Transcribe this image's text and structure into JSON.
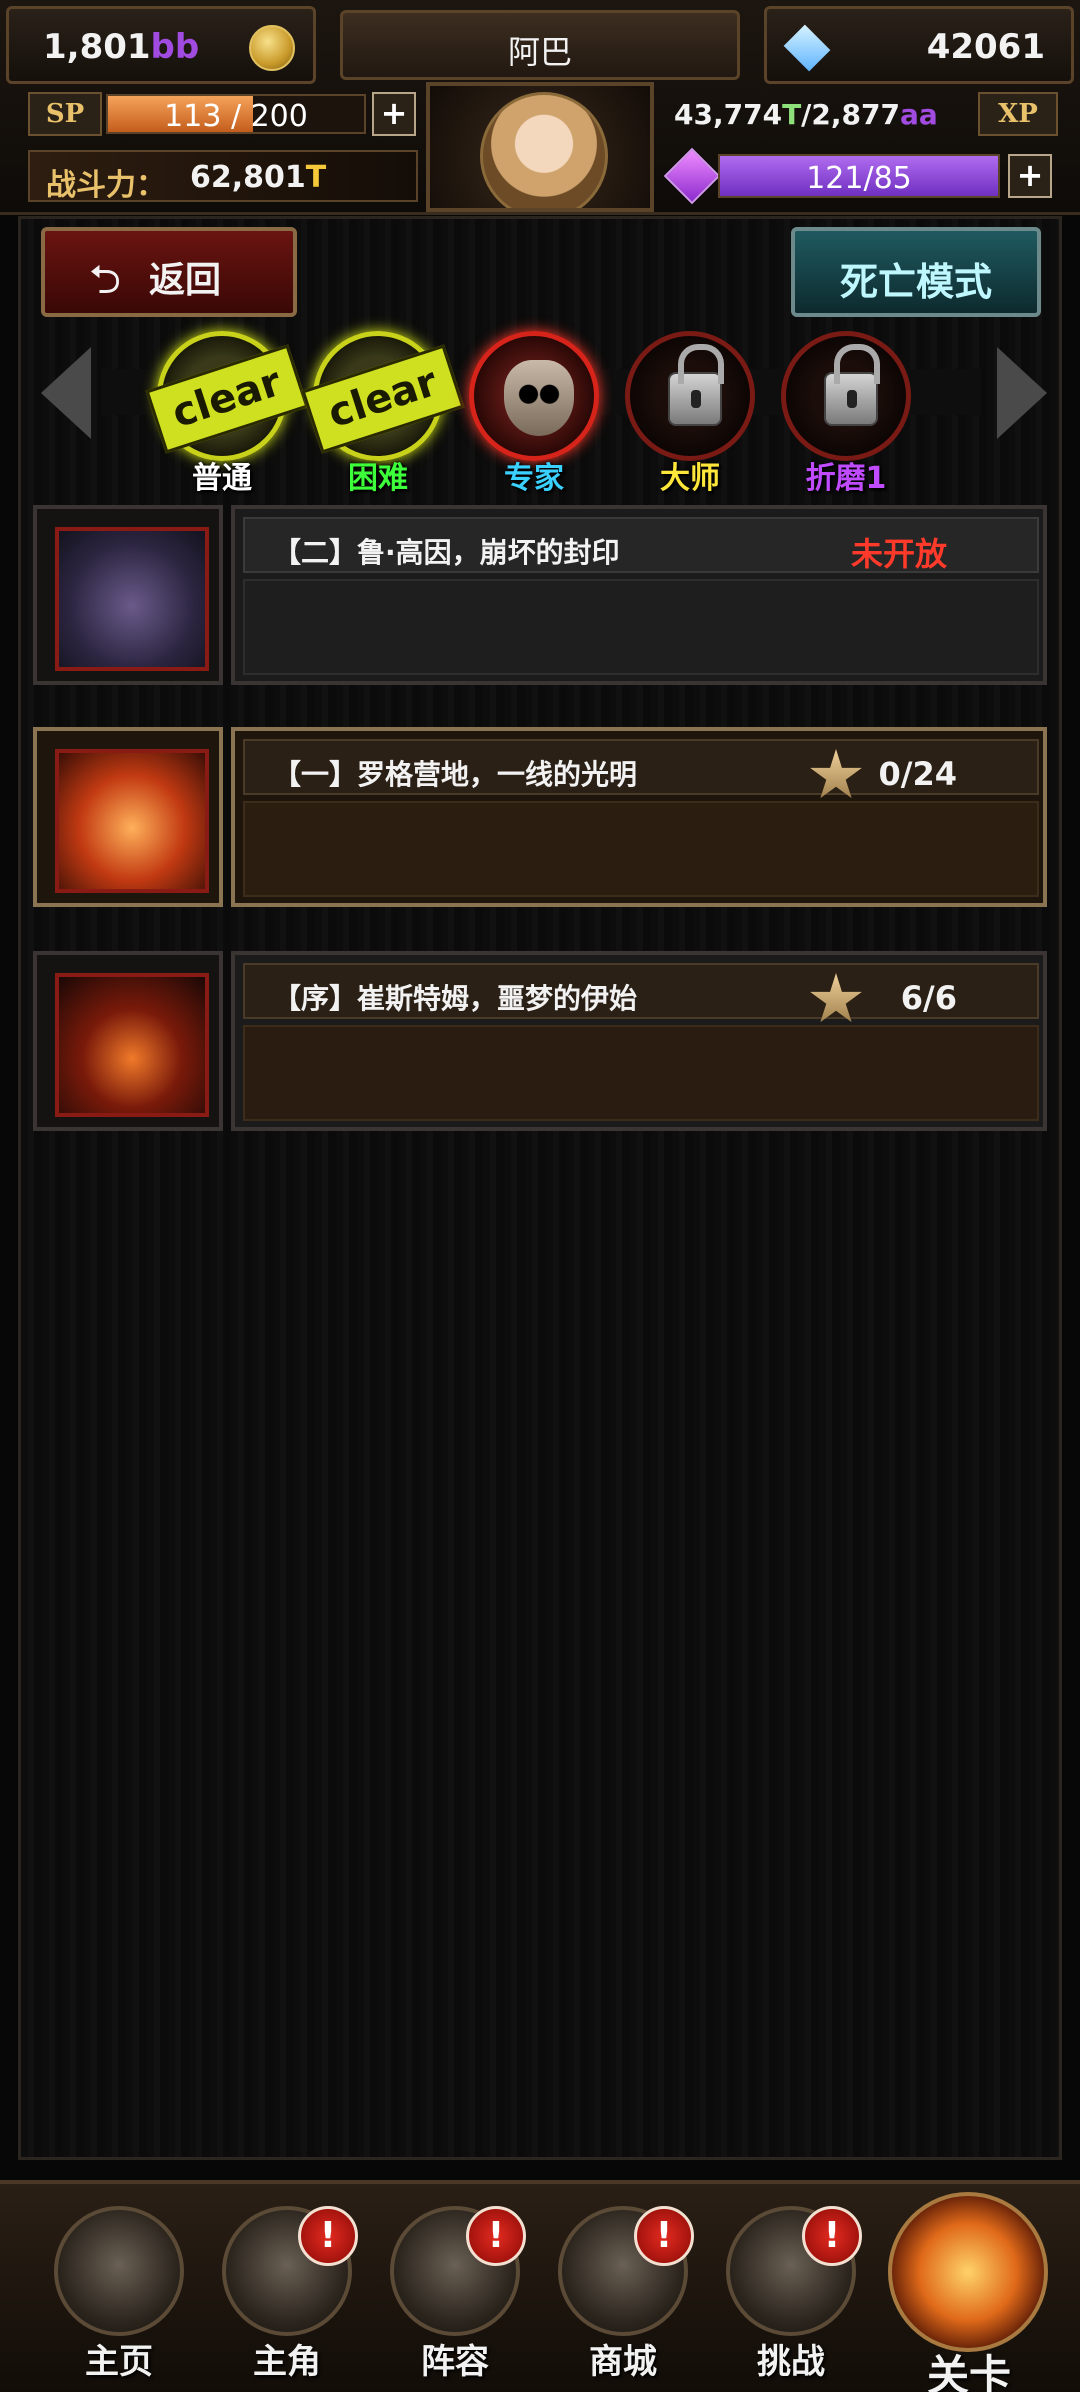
{
  "hud": {
    "gold_value": "1,801",
    "gold_unit": "bb",
    "player_name": "阿巴",
    "gems": "42061",
    "sp_label": "SP",
    "sp_text": "113 / 200",
    "sp_fraction": 0.565,
    "power_label": "战斗力：",
    "power_value": "62,801",
    "power_unit": "T",
    "xp_current": "43,774",
    "xp_current_unit": "T",
    "xp_sep": "/",
    "xp_max": "2,877",
    "xp_max_unit": "aa",
    "xp_label": "XP",
    "crystal_text": "121/85",
    "plus": "+"
  },
  "buttons": {
    "back_icon": "⮌",
    "back": "返回",
    "death_mode": "死亡模式"
  },
  "difficulties": [
    {
      "label": "普通",
      "state": "cleared",
      "stamp": "clear",
      "color": "#ffffff"
    },
    {
      "label": "困难",
      "state": "cleared",
      "stamp": "clear",
      "color": "#3dff3a"
    },
    {
      "label": "专家",
      "state": "current",
      "color": "#3ad0ff"
    },
    {
      "label": "大师",
      "state": "locked",
      "color": "#ffe63a"
    },
    {
      "label": "折磨1",
      "state": "locked",
      "color": "#c04bff"
    }
  ],
  "chapters": [
    {
      "title": "【二】鲁·高因，崩坏的封印",
      "status": "未开放"
    },
    {
      "title": "【一】罗格营地，一线的光明",
      "progress": "0/24"
    },
    {
      "title": "【序】崔斯特姆，噩梦的伊始",
      "progress": "6/6"
    }
  ],
  "nav": {
    "home": "主页",
    "hero": "主角",
    "lineup": "阵容",
    "shop": "商城",
    "challenge": "挑战",
    "stage": "关卡",
    "badge": "!"
  },
  "colors": {
    "accent_gold": "#e8c16a",
    "status_red": "#ff3a2a",
    "crystal_purple": "#8c2bcf"
  },
  "icons": [
    "coin-icon",
    "diamond-icon",
    "avatar",
    "purple-gem-icon",
    "skull-icon",
    "lock-icon",
    "star-icon",
    "back-arrow-icon"
  ]
}
